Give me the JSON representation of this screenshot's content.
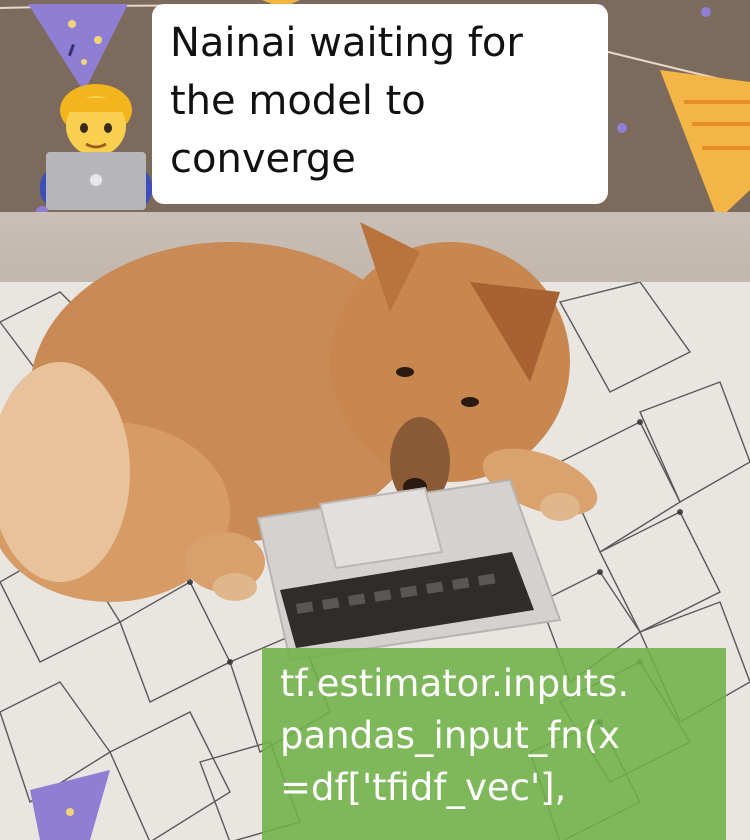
{
  "caption_top": {
    "lines": [
      "Nainai waiting for",
      "the model to",
      "converge"
    ]
  },
  "caption_code": {
    "lines": [
      "tf.estimator.inputs.",
      "pandas_input_fn(x",
      "=df['tfidf_vec'],"
    ]
  },
  "icons": {
    "emoji": "man-technologist-icon",
    "bunting": "party-bunting-icon"
  },
  "colors": {
    "top_band": "#7c6a5c",
    "caption_code_bg": "#70b248",
    "bunting_purple": "#8e7fd4",
    "bunting_orange": "#f3b545"
  }
}
